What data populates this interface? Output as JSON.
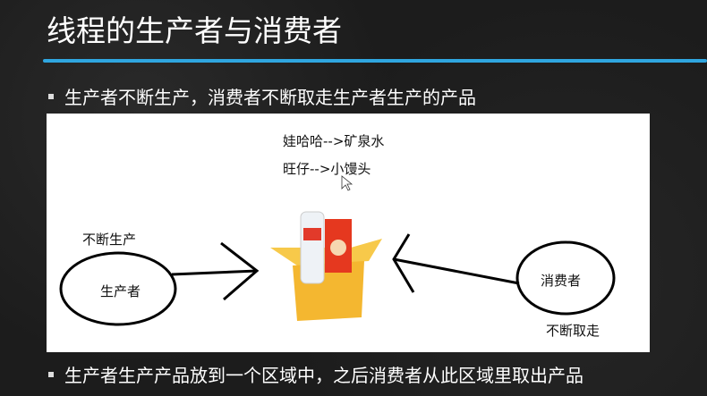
{
  "slide": {
    "title": "线程的生产者与消费者",
    "accent_color": "#2fa6e0",
    "bullets": [
      "生产者不断生产，消费者不断取走生产者生产的产品",
      "生产者生产产品放到一个区域中，之后消费者从此区域里取出产品"
    ]
  },
  "diagram": {
    "mapping": [
      "娃哈哈-->矿泉水",
      "旺仔-->小馒头"
    ],
    "producer_label": "生产者",
    "producer_note": "不断生产",
    "consumer_label": "消费者",
    "consumer_note": "不断取走"
  }
}
